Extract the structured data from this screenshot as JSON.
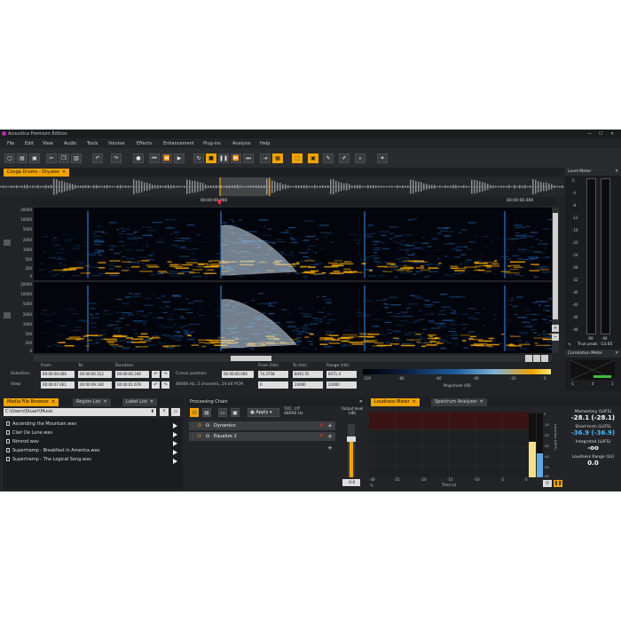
{
  "window": {
    "title": "Acoustica Premium Edition"
  },
  "menu": [
    "File",
    "Edit",
    "View",
    "Audio",
    "Tools",
    "Volume",
    "Effects",
    "Enhancement",
    "Plug-ins",
    "Analysis",
    "Help"
  ],
  "document_tab": {
    "label": "Conga Drums - Dry.wav"
  },
  "ruler": {
    "start": "00:00:00.066",
    "end": "00:00:00.000"
  },
  "freq_labels": [
    "20000",
    "10000",
    "5000",
    "2000",
    "1000",
    "500",
    "200",
    "0"
  ],
  "spectrogram_colors": {
    "low": "#0a1a3a",
    "mid": "#1f5fa0",
    "high": "#f0a400",
    "selection": "#cfe4f7"
  },
  "selection_panel": {
    "headers": {
      "from": "From:",
      "to": "To:",
      "duration": "Duration:"
    },
    "selection_label": "Selection:",
    "view_label": "View:",
    "selection": {
      "from": "00:00:00.066",
      "to": "00:00:00.312",
      "duration": "00:00:00.246"
    },
    "view": {
      "from": "00:00:07.461",
      "to": "00:00:09.140",
      "duration": "00:00:01.679"
    },
    "cursor_label": "Cursor position:",
    "cursor_value": "00:00:00.066",
    "format": "48000 Hz, 2 channels, 24 bit PCM",
    "freq_headers": {
      "from": "From (Hz):",
      "to": "To (Hz):",
      "range": "Range (Hz):"
    },
    "freq_from": "74.3758",
    "freq_to": "8445.55",
    "freq_range": "8371.4",
    "freq_from2": "0",
    "freq_to2": "24000",
    "freq_range2": "24000",
    "magnitude_label": "Magnitude (dB)",
    "magnitude_ticks": [
      "-100",
      "-80",
      "-60",
      "-40",
      "-20",
      "0"
    ]
  },
  "level_meter": {
    "title": "Level Meter",
    "ticks": [
      "0",
      "-4",
      "-8",
      "-12",
      "-16",
      "-20",
      "-24",
      "-28",
      "-32",
      "-36",
      "-40",
      "-44",
      "-48"
    ],
    "peak_left": "-90",
    "peak_right": "-90",
    "true_peak": "True peak: -13.65"
  },
  "correlation_meter": {
    "title": "Correlation Meter",
    "left": "-1",
    "mid": "0",
    "right": "1"
  },
  "bottom_tabs": [
    "Media File Browser",
    "Region List",
    "Label List"
  ],
  "browser": {
    "path": "C:\\Users\\Stuart\\Music",
    "files": [
      "Ascending the Mountain.wav",
      "Clair De Lune.wav",
      "Nimrod.wav",
      "Supertramp - Breakfast in America.wav",
      "Supertramp - The Logical Song.wav"
    ]
  },
  "processing_chain": {
    "title": "Processing Chain",
    "apply": "Apply",
    "src": "SRC off",
    "rate": "48000 Hz",
    "output_label": "Output level (dB)",
    "output_value": "-0.8",
    "items": [
      "Dynamics",
      "Equalize 2"
    ]
  },
  "loudness_tabs": [
    "Loudness Meter",
    "Spectrum Analyzer"
  ],
  "loudness": {
    "x_ticks": [
      "-30",
      "-25",
      "-20",
      "-15",
      "-10",
      "-5",
      "0"
    ],
    "x_label": "Time (s)",
    "y_label": "Loudness (LUFS)",
    "y_ticks": [
      "0",
      "-10",
      "-20",
      "-30",
      "-40",
      "-50",
      "-60"
    ],
    "momentary_label": "Momentary (LUFS)",
    "momentary_value": "-28.1 (-28.1)",
    "shortterm_label": "Short-term (LUFS)",
    "shortterm_value": "-36.9 (-36.9)",
    "integrated_label": "Integrated (LUFS)",
    "integrated_value": "-oo",
    "range_label": "Loudness Range (LU)",
    "range_value": "0.0",
    "momentary_level": 0.55,
    "shortterm_level": 0.38
  }
}
